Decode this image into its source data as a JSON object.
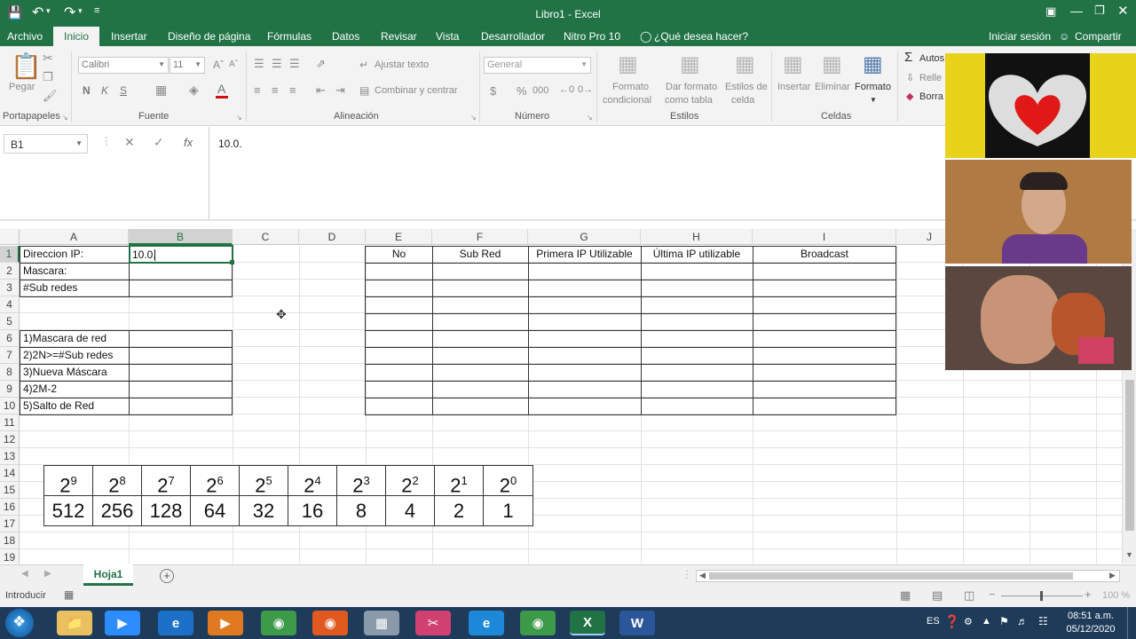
{
  "window": {
    "title": "Libro1 - Excel"
  },
  "tabs": {
    "file": "Archivo",
    "home": "Inicio",
    "insert": "Insertar",
    "layout": "Diseño de página",
    "formulas": "Fórmulas",
    "data": "Datos",
    "review": "Revisar",
    "view": "Vista",
    "developer": "Desarrollador",
    "nitro": "Nitro Pro 10",
    "tell": "¿Qué desea hacer?",
    "signin": "Iniciar sesión",
    "share": "Compartir"
  },
  "ribbon": {
    "paste": "Pegar",
    "clipboard": "Portapapeles",
    "font_name": "Calibri",
    "font_size": "11",
    "bold": "N",
    "italic": "K",
    "underline": "S",
    "font": "Fuente",
    "wrap": "Ajustar texto",
    "merge": "Combinar y centrar",
    "alignment": "Alineación",
    "number_format": "General",
    "currency": "$",
    "percent": "%",
    "thousands": "000",
    "number": "Número",
    "cond_1": "Formato",
    "cond_2": "condicional",
    "table_1": "Dar formato",
    "table_2": "como tabla",
    "cellstyles_1": "Estilos de",
    "cellstyles_2": "celda",
    "styles": "Estilos",
    "insert": "Insertar",
    "delete": "Eliminar",
    "format": "Formato",
    "cells": "Celdas",
    "autosum": "Autos",
    "fill": "Relle",
    "clear": "Borra"
  },
  "formula_bar": {
    "name_box": "B1",
    "fx": "fx",
    "content": "10.0."
  },
  "columns": [
    "A",
    "B",
    "C",
    "D",
    "E",
    "F",
    "G",
    "H",
    "I",
    "J"
  ],
  "rows": [
    "1",
    "2",
    "3",
    "4",
    "5",
    "6",
    "7",
    "8",
    "9",
    "10",
    "11",
    "12",
    "13",
    "14",
    "15",
    "16",
    "17",
    "18",
    "19"
  ],
  "cells": {
    "A1": "Direccion IP:",
    "A2": "Mascara:",
    "A3": "#Sub redes",
    "A6": "1)Mascara de red",
    "A7": "2)2N>=#Sub redes",
    "A8": "3)Nueva Máscara",
    "A9": "4)2M-2",
    "A10": "5)Salto de Red",
    "B1": "10.0.",
    "E1": "No",
    "F1": "Sub Red",
    "G1": "Primera IP Utilizable",
    "H1": "Última IP utilizable",
    "I1": "Broadcast"
  },
  "powers": {
    "exponents": [
      "9",
      "8",
      "7",
      "6",
      "5",
      "4",
      "3",
      "2",
      "1",
      "0"
    ],
    "base": "2",
    "values": [
      "512",
      "256",
      "128",
      "64",
      "32",
      "16",
      "8",
      "4",
      "2",
      "1"
    ]
  },
  "sheets": {
    "active": "Hoja1",
    "add": "+"
  },
  "status": {
    "mode": "Introducir",
    "zoom": "100 %"
  },
  "taskbar": {
    "lang": "ES",
    "time": "08:51 a.m.",
    "date": "05/12/2020"
  },
  "colors": {
    "excel_green": "#217346",
    "taskbar": "#1f3b5a",
    "selection": "#217346"
  }
}
